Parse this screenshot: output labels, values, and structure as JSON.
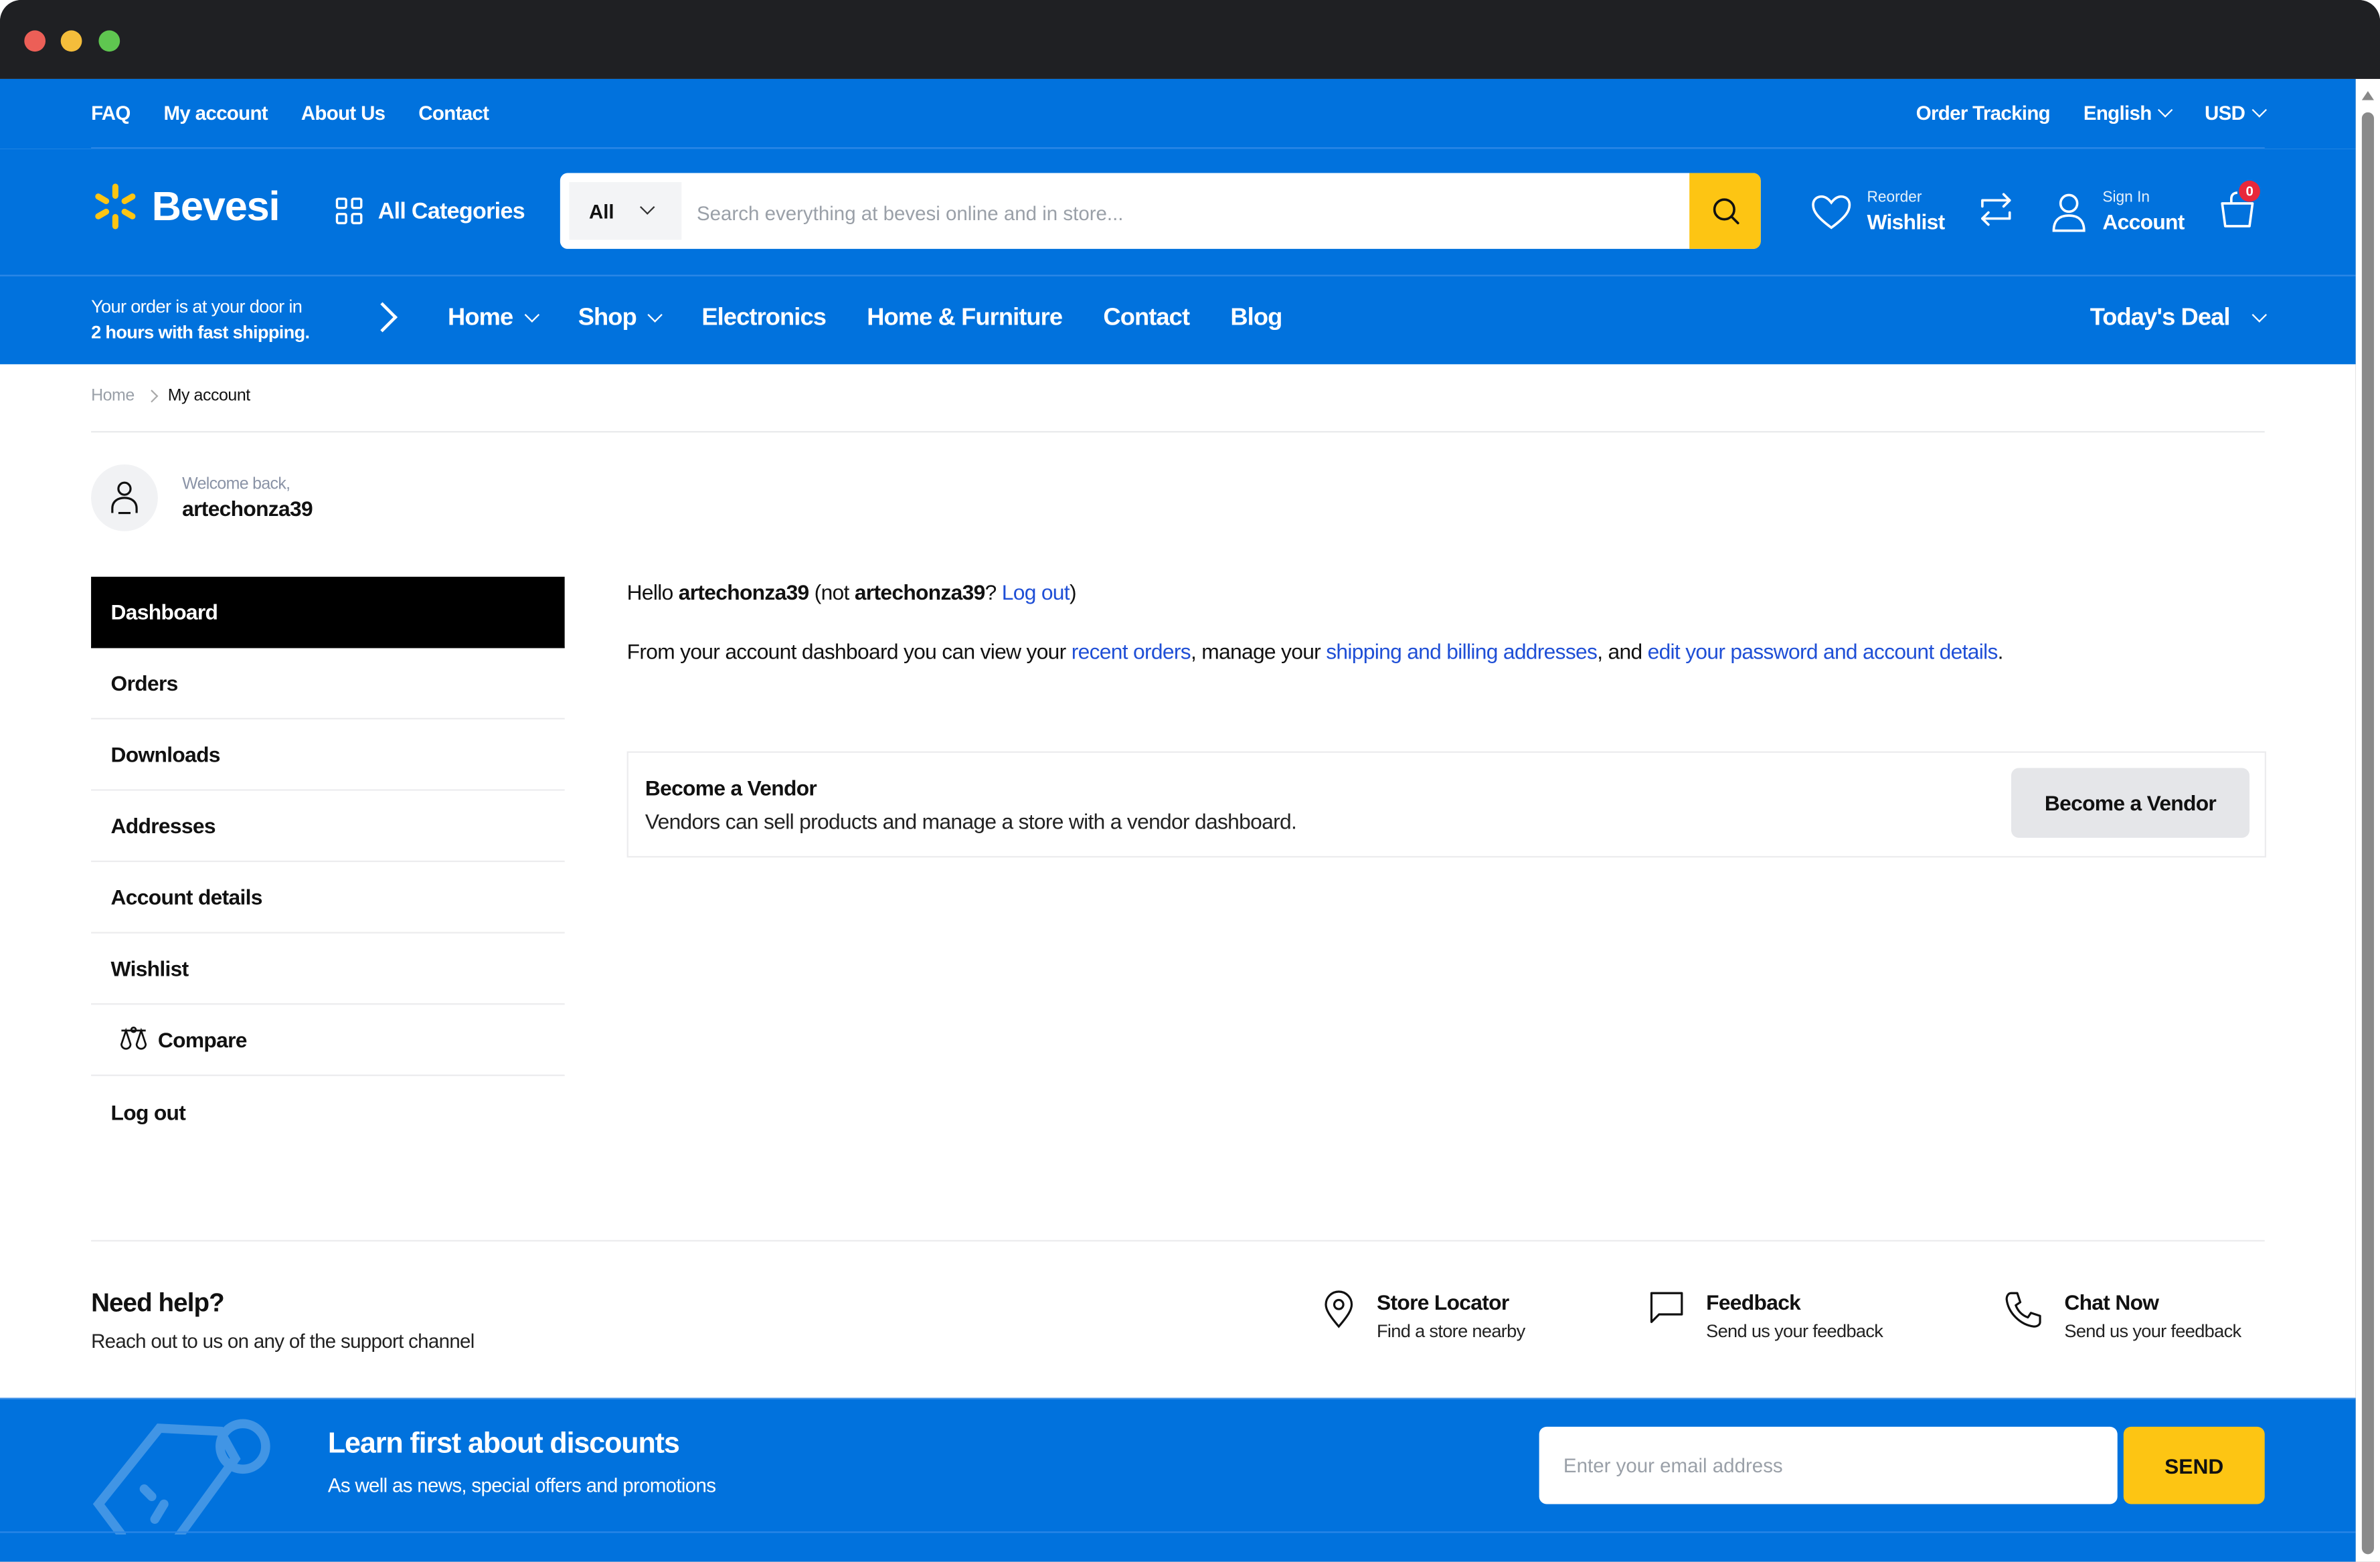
{
  "window": {
    "controls": [
      "close",
      "minimize",
      "maximize"
    ]
  },
  "colors": {
    "brand_blue": "#0172dd",
    "accent_yellow": "#fdc513",
    "badge_red": "#e8283b",
    "link_blue": "#1f4fd6",
    "active_menu": "#000000"
  },
  "topbar": {
    "links": [
      "FAQ",
      "My account",
      "About Us",
      "Contact"
    ],
    "order_tracking": "Order Tracking",
    "language": "English",
    "currency": "USD"
  },
  "header": {
    "logo": "Bevesi",
    "all_categories": "All Categories",
    "search": {
      "category": "All",
      "placeholder": "Search everything at bevesi online and in store...",
      "value": ""
    },
    "wishlist": {
      "small": "Reorder",
      "big": "Wishlist"
    },
    "account": {
      "small": "Sign In",
      "big": "Account"
    },
    "cart_count": "0"
  },
  "navbar": {
    "shipping_line1": "Your order is at your door in",
    "shipping_line2": "2 hours with fast shipping.",
    "links": [
      {
        "label": "Home",
        "dropdown": true
      },
      {
        "label": "Shop",
        "dropdown": true
      },
      {
        "label": "Electronics",
        "dropdown": false
      },
      {
        "label": "Home & Furniture",
        "dropdown": false
      },
      {
        "label": "Contact",
        "dropdown": false
      },
      {
        "label": "Blog",
        "dropdown": false
      }
    ],
    "todays_deal": "Today's Deal"
  },
  "breadcrumb": {
    "home": "Home",
    "current": "My account"
  },
  "account": {
    "welcome": "Welcome back,",
    "username": "artechonza39",
    "menu": [
      "Dashboard",
      "Orders",
      "Downloads",
      "Addresses",
      "Account details",
      "Wishlist",
      "Compare",
      "Log out"
    ],
    "active": "Dashboard"
  },
  "dashboard": {
    "hello": "Hello ",
    "user": "artechonza39",
    "not_prefix": " (not ",
    "not_user": "artechonza39",
    "q": "? ",
    "logout": "Log out",
    "close": ")",
    "desc_1": "From your account dashboard you can view your ",
    "link_orders": "recent orders",
    "desc_2": ", manage your ",
    "link_addresses": "shipping and billing addresses",
    "desc_3": ", and ",
    "link_account": "edit your password and account details",
    "desc_4": "."
  },
  "vendor": {
    "title": "Become a Vendor",
    "description": "Vendors can sell products and manage a store with a vendor dashboard.",
    "button": "Become a Vendor"
  },
  "help": {
    "title": "Need help?",
    "subtitle": "Reach out to us on any of the support channel",
    "channels": [
      {
        "icon": "map-pin-icon",
        "title": "Store Locator",
        "subtitle": "Find a store nearby"
      },
      {
        "icon": "chat-bubble-icon",
        "title": "Feedback",
        "subtitle": "Send us your feedback"
      },
      {
        "icon": "phone-icon",
        "title": "Chat Now",
        "subtitle": "Send us your feedback"
      }
    ]
  },
  "newsletter": {
    "title": "Learn first about discounts",
    "subtitle": "As well as news, special offers and promotions",
    "email_placeholder": "Enter your email address",
    "send": "SEND"
  }
}
